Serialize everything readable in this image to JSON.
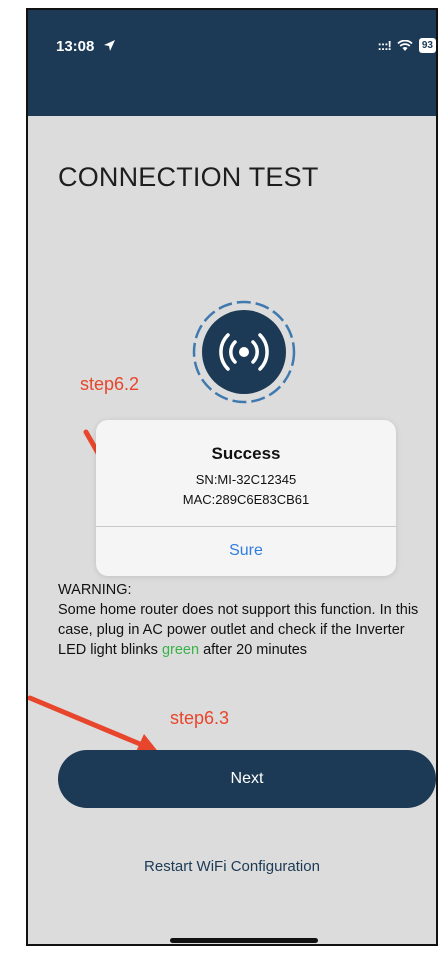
{
  "status_bar": {
    "time": "13:08",
    "signal": ":::!",
    "battery": "93"
  },
  "page": {
    "title": "CONNECTION TEST"
  },
  "annotations": {
    "step_a": "step6.2",
    "step_b": "step6.3",
    "color": "#e8462c"
  },
  "dialog": {
    "title": "Success",
    "sn": "SN:MI-32C12345",
    "mac": "MAC:289C6E83CB61",
    "button": "Sure"
  },
  "warning": {
    "heading": "WARNING:",
    "text_before": "Some home router does not support this function. In this case, plug in AC power outlet and check if the Inverter LED light blinks ",
    "green_word": "green",
    "text_after": " after 20 minutes"
  },
  "buttons": {
    "next": "Next",
    "restart": "Restart WiFi Configuration"
  },
  "colors": {
    "primary": "#1c3a55",
    "link": "#2f7de1",
    "success_green": "#3ab24a",
    "background": "#dcdcdc"
  },
  "icons": {
    "wifi_graphic": "wireless-broadcast-icon",
    "location": "location-arrow-icon",
    "wifi_status": "wifi-icon"
  }
}
